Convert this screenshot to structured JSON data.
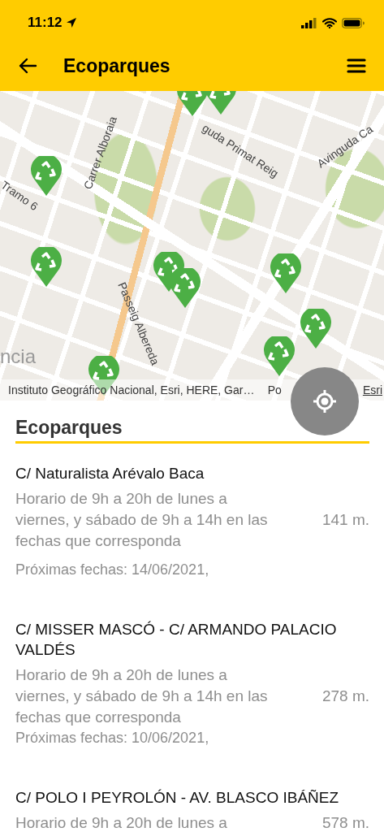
{
  "status_bar": {
    "time": "11:12"
  },
  "header": {
    "title": "Ecoparques"
  },
  "map": {
    "street_labels": [
      "guda Primat Reig",
      "Carrer Alboraia",
      "Tramo 6",
      "Avinguda Ca",
      "Passeig Albereda",
      "ncia"
    ],
    "attribution": "Instituto Geográfico Nacional, Esri, HERE, Gar…",
    "attribution_left_fragment": "Po",
    "attribution_link": "Esri"
  },
  "list": {
    "title": "Ecoparques",
    "items": [
      {
        "name": "C/ Naturalista Arévalo Baca",
        "schedule": "Horario de 9h a 20h de lunes a viernes, y sábado de 9h a 14h en las fechas que corresponda",
        "dates": "Próximas fechas: 14/06/2021,",
        "distance": "141 m."
      },
      {
        "name": "C/ MISSER MASCÓ - C/ ARMANDO PALACIO VALDÉS",
        "schedule": "Horario de 9h a 20h de lunes a viernes, y sábado de 9h a 14h en las fechas que corresponda",
        "dates": "Próximas fechas: 10/06/2021,",
        "distance": "278 m."
      },
      {
        "name": "C/ POLO I PEYROLÓN - AV. BLASCO IBÁÑEZ",
        "schedule": "Horario de 9h a 20h de lunes a",
        "distance": "578 m."
      }
    ]
  }
}
